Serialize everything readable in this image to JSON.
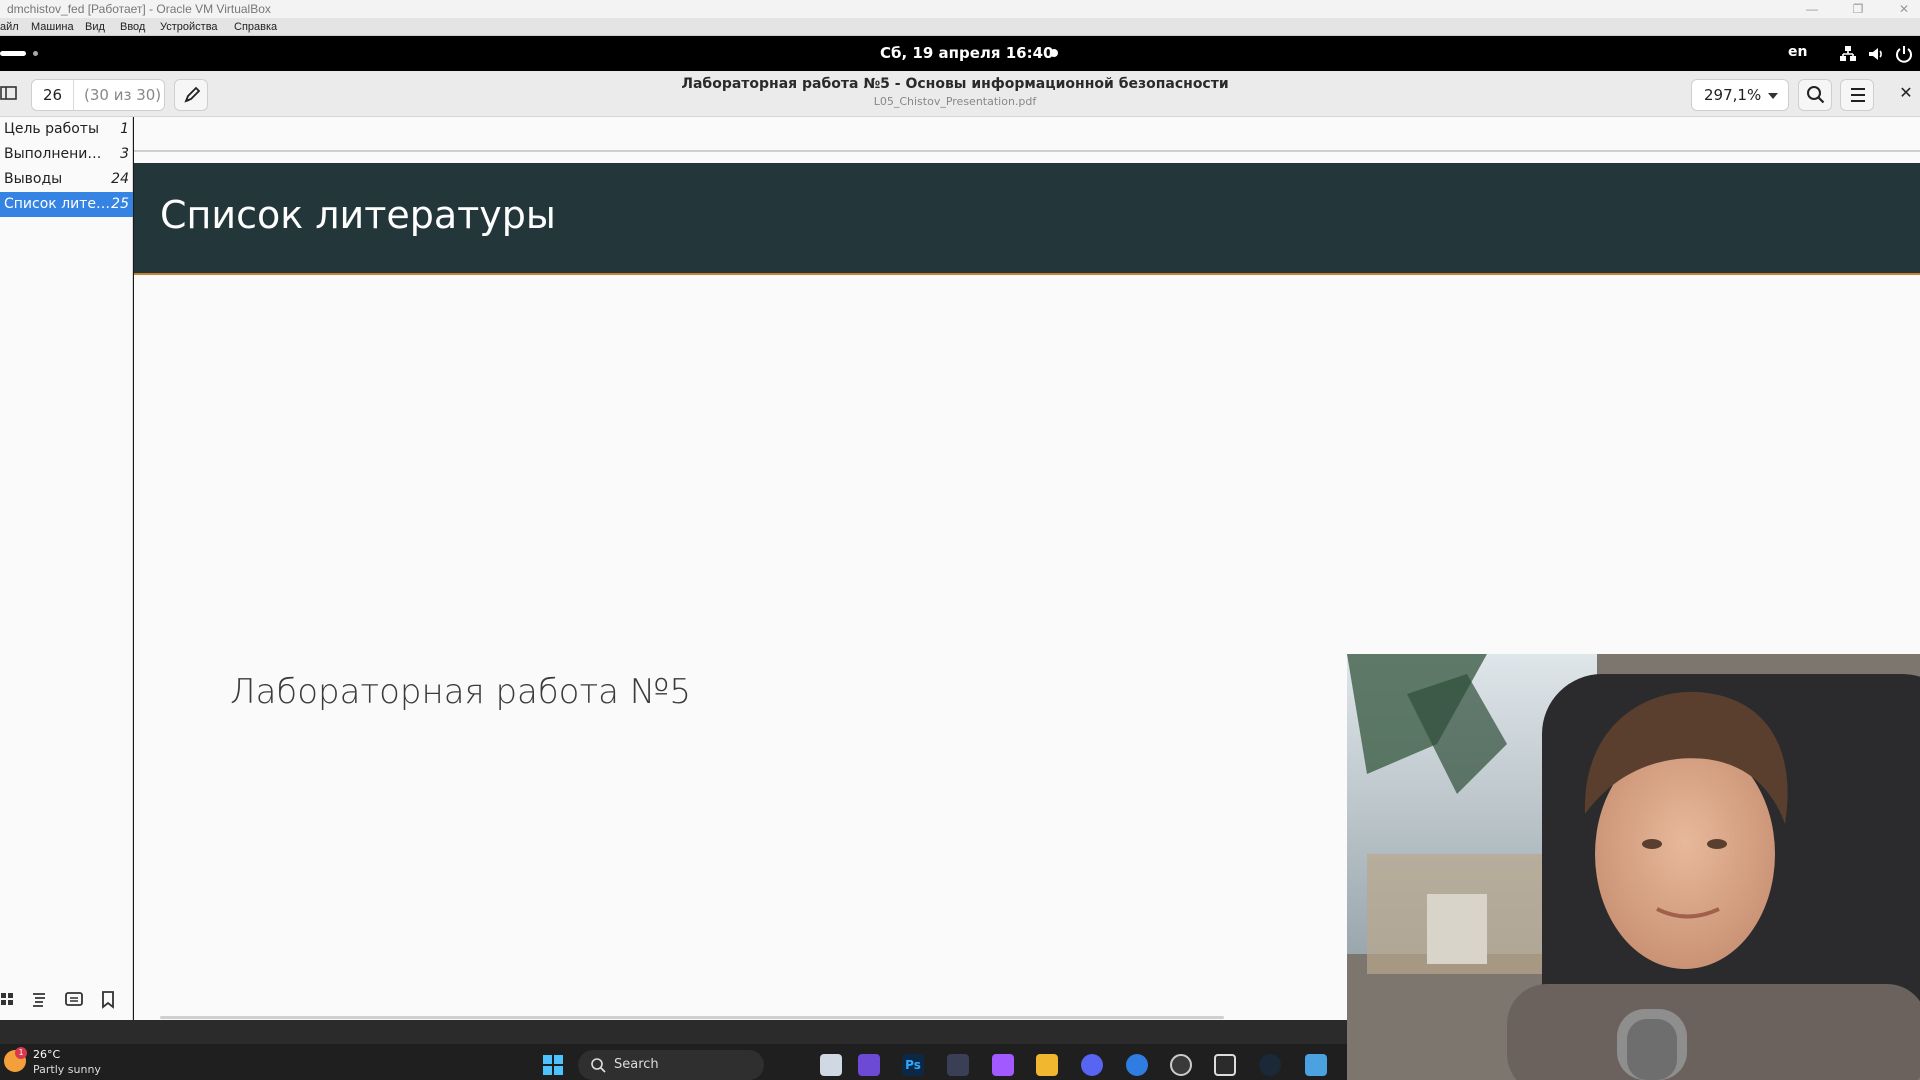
{
  "vbox": {
    "title": "dmchistov_fed [Работает] - Oracle VM VirtualBox",
    "menu": [
      "айл",
      "Машина",
      "Вид",
      "Ввод",
      "Устройства",
      "Справка"
    ]
  },
  "gnome": {
    "clock": "Сб, 19 апреля  16:40",
    "lang": "en"
  },
  "viewer": {
    "page_current": "26",
    "page_of": "(30 из 30)",
    "doc_title": "Лабораторная работа №5 - Основы информационной безопасности",
    "doc_file": "L05_Chistov_Presentation.pdf",
    "zoom": "297,1%"
  },
  "sidebar": {
    "items": [
      {
        "label": "Цель работы",
        "page": "1"
      },
      {
        "label": "Выполнени…",
        "page": "3"
      },
      {
        "label": "Выводы",
        "page": "24"
      },
      {
        "label": "Список лите…",
        "page": "25"
      }
    ],
    "active_index": 3
  },
  "slide": {
    "header": "Список литературы",
    "body": "Лабораторная работа №5"
  },
  "taskbar": {
    "weather_temp": "26°C",
    "weather_desc": "Partly sunny",
    "weather_badge": "1",
    "search_label": "Search"
  },
  "colors": {
    "accent": "#3584e4",
    "slide_header_bg": "#23373b",
    "slide_header_rule": "#c7812f"
  }
}
